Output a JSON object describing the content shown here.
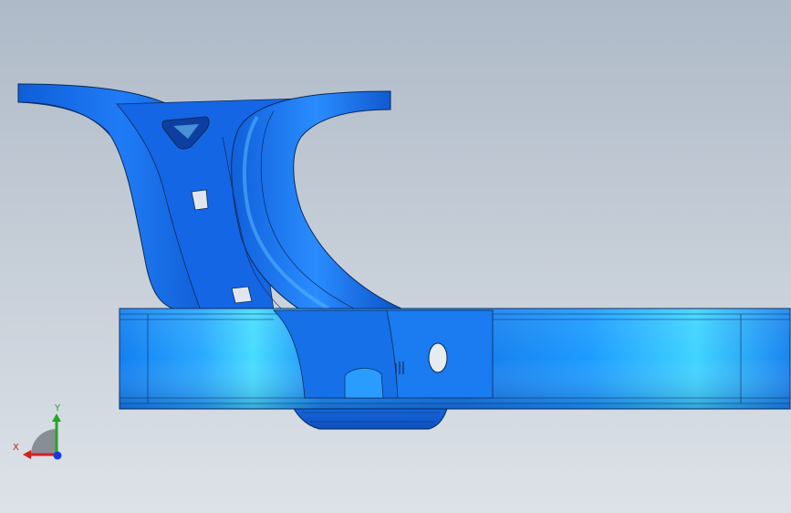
{
  "viewport": {
    "background_top": "#aebac8",
    "background_bottom": "#dde2e8",
    "model_color": "#1a6ff0",
    "model_highlight": "#3fd2ff",
    "edge_color": "#0a2a5a"
  },
  "triad": {
    "x_label": "X",
    "y_label": "Y",
    "x_color": "#d42020",
    "y_color": "#22a822",
    "z_color": "#1a3ad8"
  }
}
